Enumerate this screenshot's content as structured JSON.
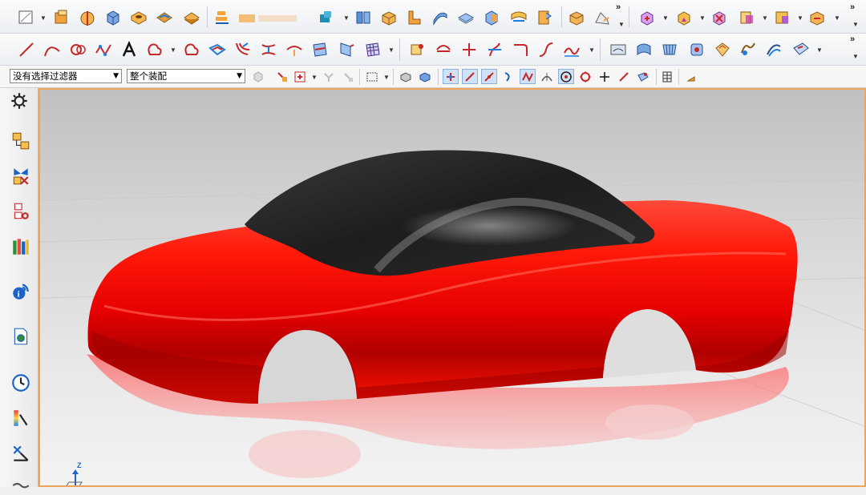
{
  "toolbar3": {
    "selection_filter": "没有选择过滤器",
    "assembly_scope": "整个装配"
  },
  "triad": {
    "z_label": "Z"
  },
  "toolbar1": {
    "icons": [
      "sketch-icon",
      "extrude-block-icon",
      "revolve-icon",
      "block-icon",
      "hole-icon",
      "edge-blend-icon",
      "chamfer-icon",
      "pattern-icon",
      "feature-group-icon",
      "trim-body-icon",
      "pipe-icon",
      "book-icon",
      "box-icon",
      "shell-icon",
      "offset-face-icon",
      "thicken-icon",
      "mirror-icon",
      "draft-icon",
      "style-surface-icon",
      "boolean-unite-icon",
      "boolean-subtract-icon",
      "boolean-intersect-icon",
      "assembly-component-icon",
      "assembly-constraint-icon",
      "move-component-icon"
    ]
  },
  "toolbar2": {
    "icons": [
      "line-icon",
      "arc-icon",
      "circle-icon",
      "spline-icon",
      "text-icon",
      "helix-icon",
      "law-curve-icon",
      "offset-curve-icon",
      "bridge-curve-icon",
      "project-curve-icon",
      "intersection-curve-icon",
      "extract-curve-icon",
      "surface-mesh-icon",
      "point-icon",
      "plane-icon",
      "isoparametric-curve-icon",
      "trim-curve-icon",
      "divide-curve-icon",
      "fillet-curve-icon",
      "curve-length-icon",
      "fit-curve-icon",
      "studio-surface-icon",
      "swept-icon",
      "through-curves-icon",
      "n-sided-surface-icon",
      "ruled-surface-icon",
      "transition-icon",
      "global-shaping-icon"
    ]
  },
  "colors": {
    "car_body": "#ff0000",
    "car_roof": "#2a2a2a",
    "viewport_border": "#f0a45a"
  }
}
